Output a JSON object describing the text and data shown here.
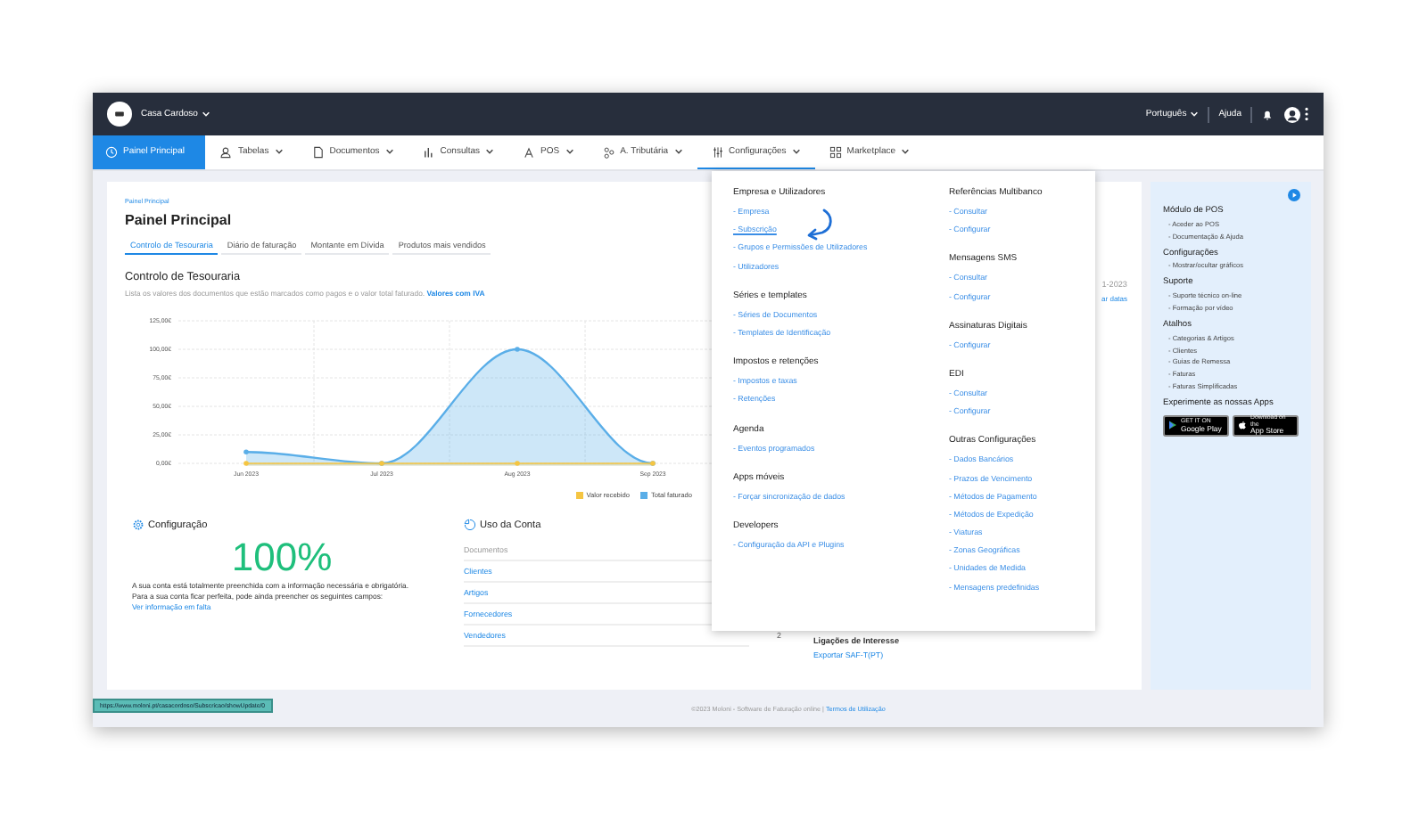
{
  "top_bar": {
    "account": "Casa Cardoso",
    "language": "Português",
    "help": "Ajuda"
  },
  "nav": [
    {
      "label": "Painel Principal",
      "selected": true,
      "open": false,
      "caret": false
    },
    {
      "label": "Tabelas",
      "selected": false,
      "open": false,
      "caret": true
    },
    {
      "label": "Documentos",
      "selected": false,
      "open": false,
      "caret": true
    },
    {
      "label": "Consultas",
      "selected": false,
      "open": false,
      "caret": true
    },
    {
      "label": "POS",
      "selected": false,
      "open": false,
      "caret": true
    },
    {
      "label": "A. Tributária",
      "selected": false,
      "open": false,
      "caret": true
    },
    {
      "label": "Configurações",
      "selected": false,
      "open": true,
      "caret": true
    },
    {
      "label": "Marketplace",
      "selected": false,
      "open": false,
      "caret": true
    }
  ],
  "breadcrumb": "Painel Principal",
  "title": "Painel Principal",
  "tabs": [
    {
      "label": "Controlo de Tesouraria",
      "selected": true
    },
    {
      "label": "Diário de faturação",
      "selected": false
    },
    {
      "label": "Montante em Dívida",
      "selected": false
    },
    {
      "label": "Produtos mais vendidos",
      "selected": false
    }
  ],
  "section": {
    "heading": "Controlo de Tesouraria",
    "description": "Lista os valores dos documentos que estão marcados como pagos e o valor total faturado.",
    "description_link": "Valores com IVA",
    "date_range": "1-2023",
    "date_link": "ar datas",
    "chart_data": {
      "type": "area",
      "grid": true,
      "categories": [
        "Jun 2023",
        "Jul 2023",
        "Aug 2023",
        "Sep 2023"
      ],
      "ylim": [
        0,
        125
      ],
      "yticks": [
        {
          "value": 0,
          "label": "0,00€"
        },
        {
          "value": 25,
          "label": "25,00€"
        },
        {
          "value": 50,
          "label": "50,00€"
        },
        {
          "value": 75,
          "label": "75,00€"
        },
        {
          "value": 100,
          "label": "100,00€"
        },
        {
          "value": 125,
          "label": "125,00€"
        }
      ],
      "series": [
        {
          "name": "Total faturado",
          "color": "#5aaee8",
          "values": [
            10,
            0,
            100,
            0
          ]
        },
        {
          "name": "Valor recebido",
          "color": "#f5c542",
          "values": [
            0,
            0,
            0,
            0
          ]
        }
      ]
    }
  },
  "configuration": {
    "title": "Configuração",
    "percent": "100%",
    "text": "A sua conta está totalmente preenchida com a informação necessária e obrigatória.",
    "text2": "Para a sua conta ficar perfeita, pode ainda preencher os seguintes campos:",
    "link": "Ver informação em falta"
  },
  "usage": {
    "title": "Uso da Conta",
    "rows": [
      {
        "label": "Documentos",
        "disabled": true
      },
      {
        "label": "Clientes",
        "disabled": false
      },
      {
        "label": "Artigos",
        "disabled": false
      },
      {
        "label": "Fornecedores",
        "disabled": false
      },
      {
        "label": "Vendedores",
        "disabled": false,
        "value": "2"
      }
    ]
  },
  "links": {
    "title": "Ligações de Interesse",
    "items": [
      "Exportar SAF-T(PT)"
    ]
  },
  "config_menu": {
    "columns": [
      {
        "groups": [
          {
            "title": "Empresa e Utilizadores",
            "items": [
              {
                "label": "- Empresa",
                "hovered": false
              },
              {
                "label": "- Subscrição",
                "hovered": true
              },
              {
                "label": "- Grupos e Permissões de Utilizadores",
                "hovered": false
              },
              {
                "label": "- Utilizadores",
                "hovered": false
              }
            ]
          },
          {
            "title": "Séries e templates",
            "items": [
              {
                "label": "- Séries de Documentos",
                "hovered": false
              },
              {
                "label": "- Templates de Identificação",
                "hovered": false
              }
            ]
          },
          {
            "title": "Impostos e retenções",
            "items": [
              {
                "label": "- Impostos e taxas",
                "hovered": false
              },
              {
                "label": "- Retenções",
                "hovered": false
              }
            ]
          },
          {
            "title": "Agenda",
            "items": [
              {
                "label": "- Eventos programados",
                "hovered": false
              }
            ]
          },
          {
            "title": "Apps móveis",
            "items": [
              {
                "label": "- Forçar sincronização de dados",
                "hovered": false
              }
            ]
          },
          {
            "title": "Developers",
            "items": [
              {
                "label": "- Configuração da API e Plugins",
                "hovered": false
              }
            ]
          }
        ]
      },
      {
        "groups": [
          {
            "title": "Referências Multibanco",
            "items": [
              {
                "label": "- Consultar",
                "hovered": false
              },
              {
                "label": "- Configurar",
                "hovered": false
              }
            ]
          },
          {
            "title": "Mensagens SMS",
            "items": [
              {
                "label": "- Consultar",
                "hovered": false
              },
              {
                "label": "- Configurar",
                "hovered": false
              }
            ]
          },
          {
            "title": "Assinaturas Digitais",
            "items": [
              {
                "label": "- Configurar",
                "hovered": false
              }
            ]
          },
          {
            "title": "EDI",
            "items": [
              {
                "label": "- Consultar",
                "hovered": false
              },
              {
                "label": "- Configurar",
                "hovered": false
              }
            ]
          },
          {
            "title": "Outras Configurações",
            "items": [
              {
                "label": "- Dados Bancários",
                "hovered": false
              },
              {
                "label": "- Prazos de Vencimento",
                "hovered": false
              },
              {
                "label": "- Métodos de Pagamento",
                "hovered": false
              },
              {
                "label": "- Métodos de Expedição",
                "hovered": false
              },
              {
                "label": "- Viaturas",
                "hovered": false
              },
              {
                "label": "- Zonas Geográficas",
                "hovered": false
              },
              {
                "label": "- Unidades de Medida",
                "hovered": false
              },
              {
                "label": "- Mensagens predefinidas",
                "hovered": false
              }
            ]
          }
        ]
      }
    ]
  },
  "sidebar": {
    "sections": [
      {
        "title": "Módulo de POS",
        "links": [
          "- Aceder ao POS",
          "- Documentação & Ajuda"
        ]
      },
      {
        "title": "Configurações",
        "links": [
          "- Mostrar/ocultar gráficos"
        ]
      },
      {
        "title": "Suporte",
        "links": [
          "- Suporte técnico on-line",
          "- Formação por vídeo"
        ]
      },
      {
        "title": "Atalhos",
        "links": [
          "- Categorias & Artigos",
          "- Clientes",
          "- Guias de Remessa",
          "- Faturas",
          "- Faturas Simplificadas"
        ]
      }
    ],
    "apps_title": "Experimente as nossas Apps",
    "badges": [
      {
        "caption": "GET IT ON",
        "store": "Google Play"
      },
      {
        "caption": "Download on the",
        "store": "App Store"
      }
    ]
  },
  "footer": {
    "text": "©2023 Moloni - Software de Faturação online |",
    "link": "Termos de Utilização"
  },
  "status_url": "https://www.moloni.pt/casacordoso/Subscricao/showUpdate/0"
}
